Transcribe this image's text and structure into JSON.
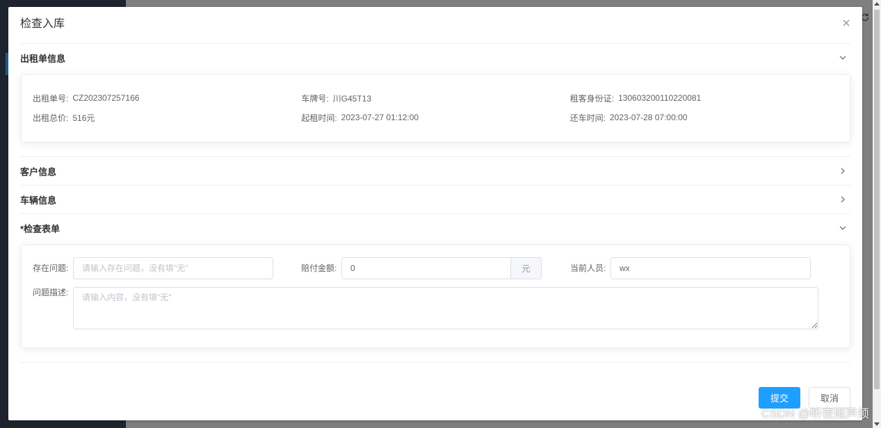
{
  "dialog": {
    "title": "检查入库",
    "close_icon": "close-icon"
  },
  "rental_section": {
    "title": "出租单信息",
    "expanded": true,
    "toggle_icon": "chevron-down-icon",
    "fields": [
      {
        "label": "出租单号:",
        "value": "CZ202307257166"
      },
      {
        "label": "车牌号:",
        "value": "川G45T13"
      },
      {
        "label": "租客身份证:",
        "value": "130603200110220081"
      },
      {
        "label": "出租总价:",
        "value": "516元"
      },
      {
        "label": "起租时间:",
        "value": "2023-07-27 01:12:00"
      },
      {
        "label": "还车时间:",
        "value": "2023-07-28 07:00:00"
      }
    ]
  },
  "customer_section": {
    "title": "客户信息",
    "expanded": false,
    "toggle_icon": "chevron-right-icon"
  },
  "vehicle_section": {
    "title": "车辆信息",
    "expanded": false,
    "toggle_icon": "chevron-right-icon"
  },
  "inspection_section": {
    "title": "*检查表单",
    "expanded": true,
    "toggle_icon": "chevron-down-icon",
    "problem": {
      "label": "存在问题:",
      "value": "",
      "placeholder": "请输入存在问题，没有填\"无\""
    },
    "compensation": {
      "label": "赔付金额:",
      "value": "0",
      "unit": "元"
    },
    "staff": {
      "label": "当前人员:",
      "value": "wx"
    },
    "description": {
      "label": "问题描述:",
      "value": "",
      "placeholder": "请输入内容，没有填\"无\""
    }
  },
  "footer": {
    "submit_label": "提交",
    "cancel_label": "取消"
  },
  "background": {
    "icon": "refresh-icon"
  },
  "watermark": "CSDN @听夜雨声烦",
  "colors": {
    "primary": "#1E9FFF",
    "overlay": "#7f7f7f",
    "sidebar": "#1d242d"
  }
}
